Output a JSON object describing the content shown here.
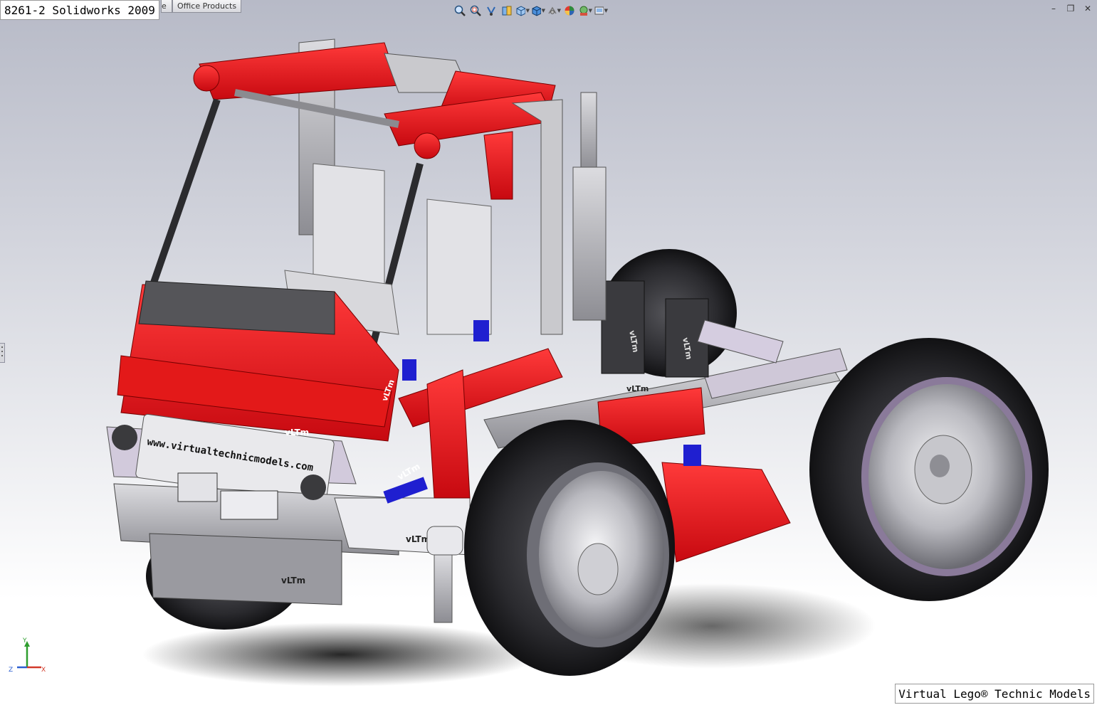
{
  "window": {
    "title_label": "8261-2 Solidworks 2009",
    "tabs": [
      {
        "label": "e"
      },
      {
        "label": "Office Products"
      }
    ]
  },
  "heads_up_toolbar": {
    "buttons": [
      {
        "icon": "zoom-to-fit-icon"
      },
      {
        "icon": "zoom-to-area-icon"
      },
      {
        "icon": "previous-view-icon"
      },
      {
        "icon": "section-view-icon"
      },
      {
        "icon": "view-orientation-icon"
      },
      {
        "icon": "display-style-icon"
      },
      {
        "icon": "hide-show-items-icon"
      },
      {
        "icon": "edit-appearance-icon"
      },
      {
        "icon": "apply-scene-icon"
      },
      {
        "icon": "view-settings-icon"
      }
    ]
  },
  "model": {
    "plate_text": "www.virtualtechnicmodels.com",
    "part_marks": [
      "vLTm",
      "vLTm",
      "vLTm",
      "vLTm",
      "vLTm",
      "vLTm",
      "vLTm",
      "vLTm"
    ],
    "colors": {
      "red": "#e8101c",
      "grey": "#a6a6ab",
      "dark": "#2a2a2e",
      "lilac": "#d9cfe3",
      "blue": "#1f1fd0"
    }
  },
  "triad": {
    "y": "Y",
    "z": "Z",
    "x": "X"
  },
  "credit": "Virtual Lego® Technic Models"
}
